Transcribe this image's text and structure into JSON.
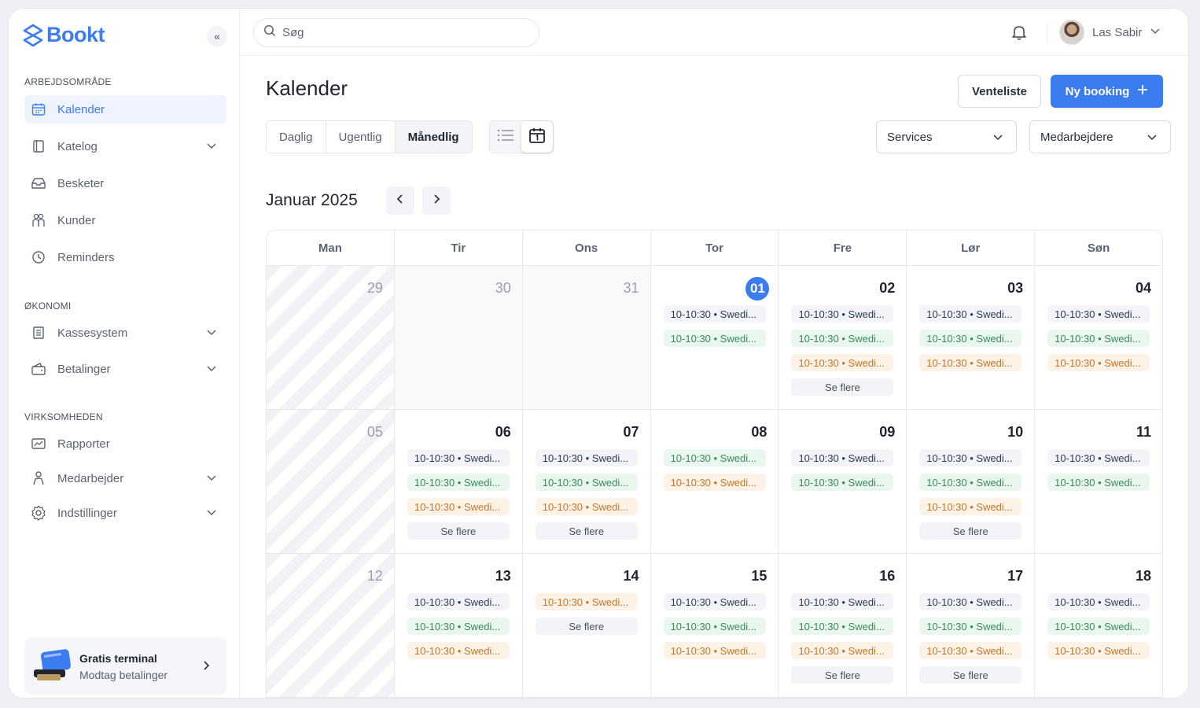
{
  "app": {
    "brand": "Bookt"
  },
  "sidebar": {
    "sections": [
      {
        "label": "ARBEJDSOMRÅDE"
      },
      {
        "label": "ØKONOMI"
      },
      {
        "label": "VIRKSOMHEDEN"
      }
    ],
    "items": [
      {
        "label": "Kalender",
        "icon": "calendar-icon",
        "active": true
      },
      {
        "label": "Katelog",
        "icon": "book-icon",
        "expandable": true
      },
      {
        "label": "Besketer",
        "icon": "inbox-icon"
      },
      {
        "label": "Kunder",
        "icon": "users-icon"
      },
      {
        "label": "Reminders",
        "icon": "reminder-icon"
      },
      {
        "label": "Kassesystem",
        "icon": "register-icon",
        "expandable": true
      },
      {
        "label": "Betalinger",
        "icon": "wallet-icon",
        "expandable": true
      },
      {
        "label": "Rapporter",
        "icon": "report-icon"
      },
      {
        "label": "Medarbejder",
        "icon": "staff-icon",
        "expandable": true
      },
      {
        "label": "Indstillinger",
        "icon": "settings-icon",
        "expandable": true
      }
    ],
    "promo": {
      "title": "Gratis terminal",
      "subtitle": "Modtag betalinger"
    }
  },
  "topbar": {
    "search_placeholder": "Søg",
    "user_name": "Las Sabir"
  },
  "main": {
    "title": "Kalender",
    "waitlist_label": "Venteliste",
    "new_booking_label": "Ny booking",
    "view_tabs": [
      {
        "label": "Daglig"
      },
      {
        "label": "Ugentlig"
      },
      {
        "label": "Månedlig",
        "active": true
      }
    ],
    "filters": {
      "services": "Services",
      "employees": "Medarbejdere"
    },
    "month_label": "Januar 2025"
  },
  "calendar": {
    "weekdays": [
      "Man",
      "Tir",
      "Ons",
      "Tor",
      "Fre",
      "Lør",
      "Søn"
    ],
    "weeks": [
      [
        {
          "day": "29",
          "state": "hatched",
          "events": []
        },
        {
          "day": "30",
          "state": "muted",
          "events": []
        },
        {
          "day": "31",
          "state": "muted",
          "events": []
        },
        {
          "day": "01",
          "today": true,
          "events": [
            {
              "text": "10-10:30 • Swedi...",
              "color": "blue"
            },
            {
              "text": "10-10:30 • Swedi...",
              "color": "green"
            }
          ]
        },
        {
          "day": "02",
          "events": [
            {
              "text": "10-10:30 • Swedi...",
              "color": "blue"
            },
            {
              "text": "10-10:30 • Swedi...",
              "color": "green"
            },
            {
              "text": "10-10:30 • Swedi...",
              "color": "orange"
            }
          ],
          "more": "Se flere"
        },
        {
          "day": "03",
          "events": [
            {
              "text": "10-10:30 • Swedi...",
              "color": "blue"
            },
            {
              "text": "10-10:30 • Swedi...",
              "color": "green"
            },
            {
              "text": "10-10:30 • Swedi...",
              "color": "orange"
            }
          ]
        },
        {
          "day": "04",
          "events": [
            {
              "text": "10-10:30 • Swedi...",
              "color": "blue"
            },
            {
              "text": "10-10:30 • Swedi...",
              "color": "green"
            },
            {
              "text": "10-10:30 • Swedi...",
              "color": "orange"
            }
          ]
        }
      ],
      [
        {
          "day": "05",
          "state": "hatched",
          "events": []
        },
        {
          "day": "06",
          "events": [
            {
              "text": "10-10:30 • Swedi...",
              "color": "blue"
            },
            {
              "text": "10-10:30 • Swedi...",
              "color": "green"
            },
            {
              "text": "10-10:30 • Swedi...",
              "color": "orange"
            }
          ],
          "more": "Se flere"
        },
        {
          "day": "07",
          "events": [
            {
              "text": "10-10:30 • Swedi...",
              "color": "blue"
            },
            {
              "text": "10-10:30 • Swedi...",
              "color": "green"
            },
            {
              "text": "10-10:30 • Swedi...",
              "color": "orange"
            }
          ],
          "more": "Se flere"
        },
        {
          "day": "08",
          "events": [
            {
              "text": "10-10:30 • Swedi...",
              "color": "green"
            },
            {
              "text": "10-10:30 • Swedi...",
              "color": "orange"
            }
          ]
        },
        {
          "day": "09",
          "events": [
            {
              "text": "10-10:30 • Swedi...",
              "color": "blue"
            },
            {
              "text": "10-10:30 • Swedi...",
              "color": "green"
            }
          ]
        },
        {
          "day": "10",
          "events": [
            {
              "text": "10-10:30 • Swedi...",
              "color": "blue"
            },
            {
              "text": "10-10:30 • Swedi...",
              "color": "green"
            },
            {
              "text": "10-10:30 • Swedi...",
              "color": "orange"
            }
          ],
          "more": "Se flere"
        },
        {
          "day": "11",
          "events": [
            {
              "text": "10-10:30 • Swedi...",
              "color": "blue"
            },
            {
              "text": "10-10:30 • Swedi...",
              "color": "green"
            }
          ]
        }
      ],
      [
        {
          "day": "12",
          "state": "hatched",
          "events": []
        },
        {
          "day": "13",
          "events": [
            {
              "text": "10-10:30 • Swedi...",
              "color": "blue"
            },
            {
              "text": "10-10:30 • Swedi...",
              "color": "green"
            },
            {
              "text": "10-10:30 • Swedi...",
              "color": "orange"
            }
          ]
        },
        {
          "day": "14",
          "events": [
            {
              "text": "10-10:30 • Swedi...",
              "color": "orange"
            }
          ],
          "more": "Se flere"
        },
        {
          "day": "15",
          "events": [
            {
              "text": "10-10:30 • Swedi...",
              "color": "blue"
            },
            {
              "text": "10-10:30 • Swedi...",
              "color": "green"
            },
            {
              "text": "10-10:30 • Swedi...",
              "color": "orange"
            }
          ]
        },
        {
          "day": "16",
          "events": [
            {
              "text": "10-10:30 • Swedi...",
              "color": "blue"
            },
            {
              "text": "10-10:30 • Swedi...",
              "color": "green"
            },
            {
              "text": "10-10:30 • Swedi...",
              "color": "orange"
            }
          ],
          "more": "Se flere"
        },
        {
          "day": "17",
          "events": [
            {
              "text": "10-10:30 • Swedi...",
              "color": "blue"
            },
            {
              "text": "10-10:30 • Swedi...",
              "color": "green"
            },
            {
              "text": "10-10:30 • Swedi...",
              "color": "orange"
            }
          ],
          "more": "Se flere"
        },
        {
          "day": "18",
          "events": [
            {
              "text": "10-10:30 • Swedi...",
              "color": "blue"
            },
            {
              "text": "10-10:30 • Swedi...",
              "color": "green"
            },
            {
              "text": "10-10:30 • Swedi...",
              "color": "orange"
            }
          ]
        }
      ]
    ]
  },
  "colors": {
    "accent": "#3b7cf0",
    "event_blue": "#2d3a55",
    "event_green": "#3a8a5c",
    "event_orange": "#c7752a"
  }
}
